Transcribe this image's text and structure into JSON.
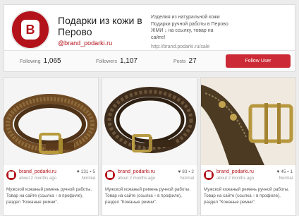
{
  "profile": {
    "name": "Подарки из кожи в Перово",
    "handle": "@brand_podarki.ru",
    "bio": "Изделия из натуральной кожи Подарки ручной работы в Перово ЖМИ ↓ на ссылку, товар на сайте!",
    "link": "http://brand.podarki.ru/sale",
    "avatar_letter": "B",
    "brand_color": "#b3121b"
  },
  "stats": {
    "following_label": "Following",
    "following_value": "1,065",
    "followers_label": "Followers",
    "followers_value": "1,107",
    "posts_label": "Posts",
    "posts_value": "27",
    "follow_button": "Follow User"
  },
  "posts": [
    {
      "user": "brand_podarki.ru",
      "time": "about 2 months ago",
      "likes": "131",
      "comments": "5",
      "quality": "Normal",
      "description": "Мужской кожаный ремень ручной работы. Товар на сайте (ссылка ↑ в профиле), раздел \"Кожаные ремни\"."
    },
    {
      "user": "brand_podarki.ru",
      "time": "about 2 months ago",
      "likes": "83",
      "comments": "2",
      "quality": "Normal",
      "description": "Мужской кожаный ремень ручной работы. Товар на сайте (ссылка ↑ в профиле), раздел \"Кожаные ремни\"."
    },
    {
      "user": "brand_podarki.ru",
      "time": "about 2 months ago",
      "likes": "45",
      "comments": "1",
      "quality": "Normal",
      "description": "Мужской кожаный ремень ручной работы. Товар на сайте (ссылка ↑ в профиле), раздел \"Кожаные ремни\"."
    }
  ]
}
